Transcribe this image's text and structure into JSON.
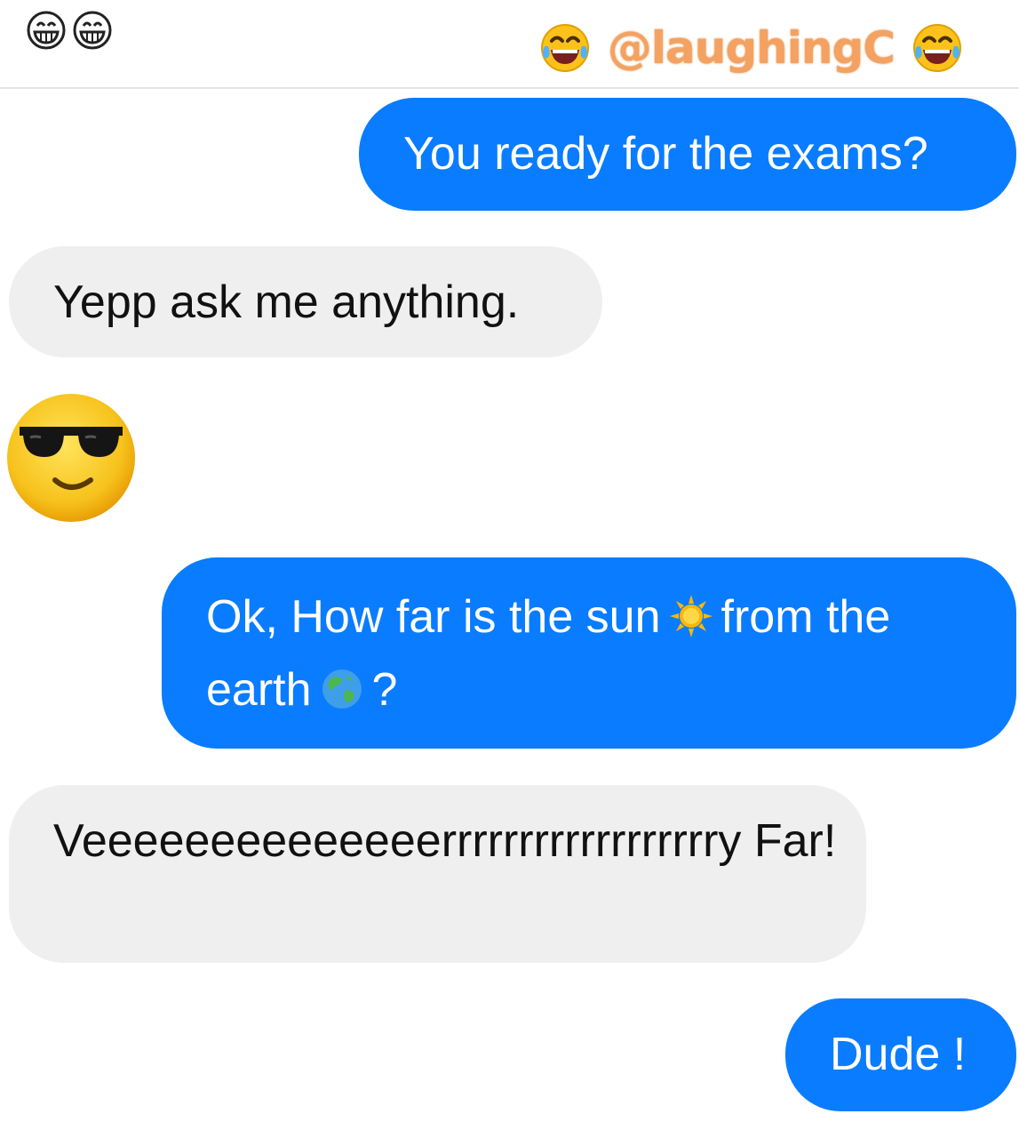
{
  "header": {
    "left_icons": [
      "grinning-face-icon",
      "grinning-face-icon"
    ],
    "watermark": {
      "text": "@laughingC",
      "icons": [
        "tears-of-joy-icon",
        "tears-of-joy-icon"
      ],
      "color": "#f4a261"
    }
  },
  "colors": {
    "outgoing_bubble": "#0a7cff",
    "incoming_bubble": "#efefef"
  },
  "messages": [
    {
      "side": "outgoing",
      "text": "You ready for the exams?"
    },
    {
      "side": "incoming",
      "text": "Yepp ask me anything."
    },
    {
      "side": "incoming",
      "type": "sticker",
      "icon": "sunglasses-face-icon"
    },
    {
      "side": "outgoing",
      "text_part1": "Ok, How far is the sun",
      "icon1": "sun-icon",
      "text_part2": "from the earth",
      "icon2": "earth-globe-icon",
      "text_part3": "?"
    },
    {
      "side": "incoming",
      "text": "Veeeeeeeeeeeeeerrrrrrrrrrrrrrrrrry Far!"
    },
    {
      "side": "outgoing",
      "text": "Dude !"
    }
  ]
}
